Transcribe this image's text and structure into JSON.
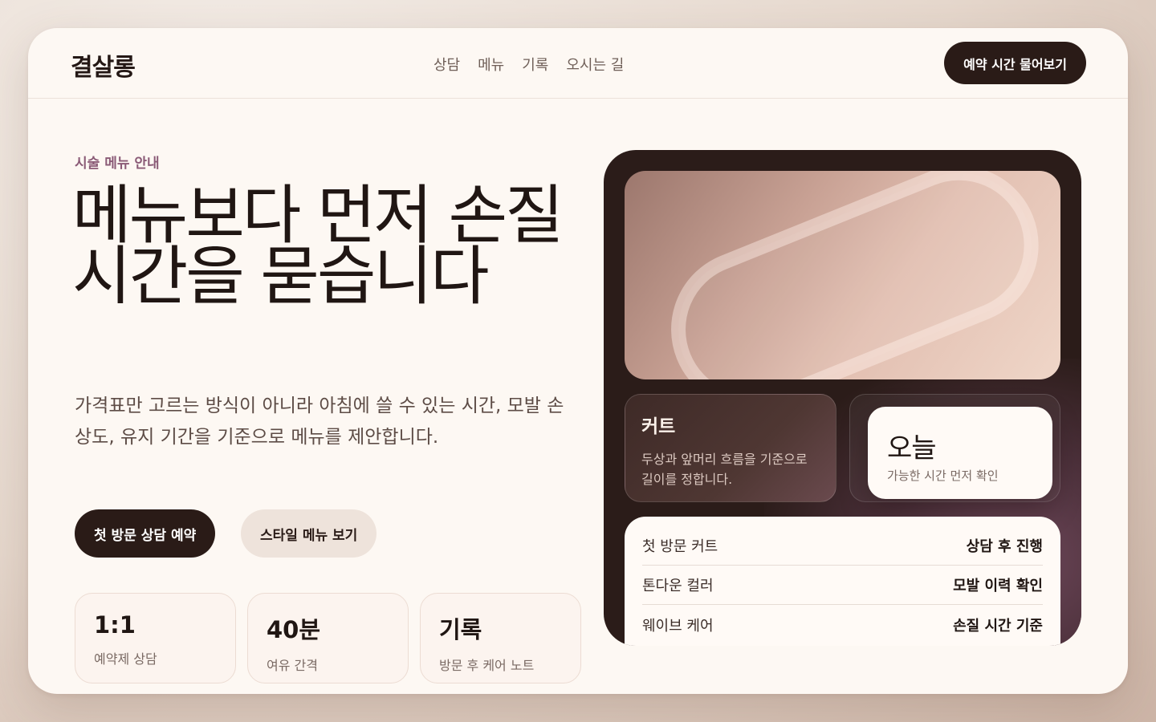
{
  "header": {
    "brand": "결살롱",
    "nav": [
      "상담",
      "메뉴",
      "기록",
      "오시는 길"
    ],
    "cta": "예약 시간 물어보기"
  },
  "hero": {
    "eyebrow": "시술 메뉴 안내",
    "headline": "메뉴보다 먼저 손질 시간을 묻습니다",
    "lead": "가격표만 고르는 방식이 아니라 아침에 쓸 수 있는 시간, 모발 손상도, 유지 기간을 기준으로 메뉴를 제안합니다.",
    "primary_button": "첫 방문 상담 예약",
    "secondary_button": "스타일 메뉴 보기"
  },
  "stats": [
    {
      "value": "1:1",
      "label": "예약제 상담"
    },
    {
      "value": "40분",
      "label": "여유 간격"
    },
    {
      "value": "기록",
      "label": "방문 후 케어 노트"
    }
  ],
  "panel": {
    "cut_card": {
      "title": "커트",
      "desc": "두상과 앞머리 흐름을 기준으로 길이를 정합니다."
    },
    "today_card": {
      "title": "오늘",
      "desc": "가능한 시간 먼저 확인"
    },
    "menu_rows": [
      {
        "name": "첫 방문 커트",
        "status": "상담 후 진행"
      },
      {
        "name": "톤다운 컬러",
        "status": "모발 이력 확인"
      },
      {
        "name": "웨이브 케어",
        "status": "손질 시간 기준"
      }
    ]
  },
  "colors": {
    "accent_dark": "#2a1b17",
    "eyebrow": "#8a5a76",
    "background": "#fdf8f3"
  }
}
